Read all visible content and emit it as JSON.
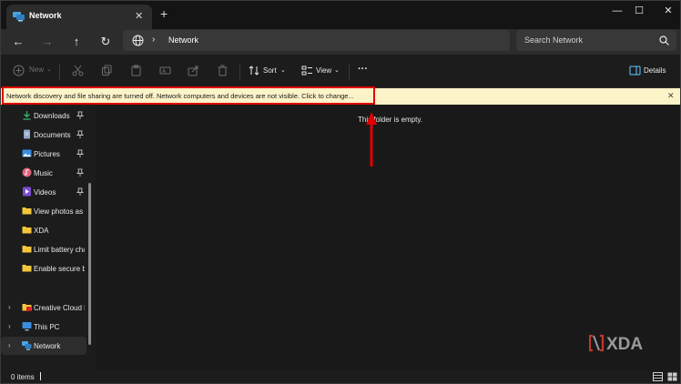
{
  "window": {
    "tab_title": "Network",
    "tab_close": "✕",
    "new_tab": "+",
    "controls": {
      "minimize": "—",
      "maximize": "☐",
      "close": "✕"
    }
  },
  "nav": {
    "back": "←",
    "forward": "→",
    "up": "↑",
    "refresh": "↻",
    "address_chevron": "›",
    "address_path": "Network",
    "search_placeholder": "Search Network"
  },
  "commandbar": {
    "new_label": "New",
    "sort_label": "Sort",
    "view_label": "View",
    "more_label": "···",
    "details_label": "Details"
  },
  "banner": {
    "message": "Network discovery and file sharing are turned off. Network computers and devices are not visible. Click to change...",
    "close": "✕"
  },
  "sidebar": {
    "quick_access": [
      {
        "label": "Downloads",
        "icon": "download-icon",
        "pinned": true
      },
      {
        "label": "Documents",
        "icon": "document-icon",
        "pinned": true
      },
      {
        "label": "Pictures",
        "icon": "pictures-icon",
        "pinned": true
      },
      {
        "label": "Music",
        "icon": "music-icon",
        "pinned": true
      },
      {
        "label": "Videos",
        "icon": "videos-icon",
        "pinned": true
      },
      {
        "label": "View photos as s",
        "icon": "folder-icon",
        "pinned": false
      },
      {
        "label": "XDA",
        "icon": "folder-icon",
        "pinned": false
      },
      {
        "label": "Limit battery cha",
        "icon": "folder-icon",
        "pinned": false
      },
      {
        "label": "Enable secure bo",
        "icon": "folder-icon",
        "pinned": false
      }
    ],
    "locations": [
      {
        "label": "Creative Cloud F",
        "icon": "creative-cloud-icon",
        "expand": "›"
      },
      {
        "label": "This PC",
        "icon": "pc-icon",
        "expand": "›"
      },
      {
        "label": "Network",
        "icon": "network-icon",
        "expand": "›",
        "selected": true
      }
    ]
  },
  "content": {
    "empty_message": "This folder is empty."
  },
  "watermark": {
    "text": "XDA"
  },
  "status": {
    "item_count": "0 items"
  },
  "colors": {
    "background": "#1c1c1c",
    "banner": "#fdf3c8",
    "highlight": "#e00000",
    "folder": "#f4c63a",
    "accent": "#60cdff"
  }
}
